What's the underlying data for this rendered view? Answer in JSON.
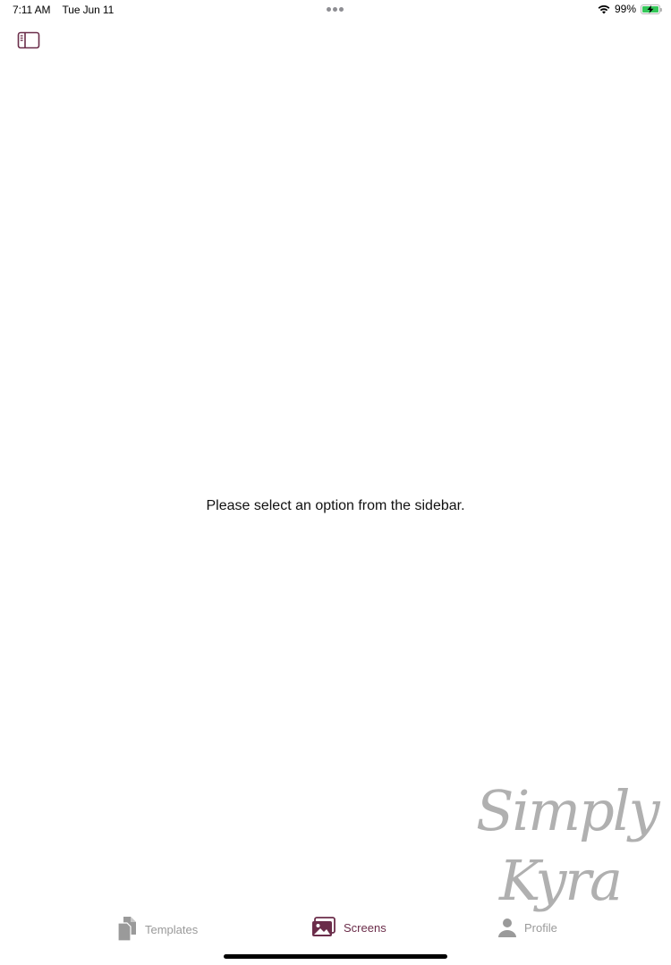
{
  "status_bar": {
    "time": "7:11 AM",
    "date": "Tue Jun 11",
    "battery": "99%",
    "battery_level": 0.99,
    "battery_color": "#34c759"
  },
  "toolbar": {
    "sidebar_toggle_icon": "sidebar-left-icon"
  },
  "main": {
    "message": "Please select an option from the sidebar."
  },
  "tab_bar": {
    "tabs": [
      {
        "label": "Templates",
        "icon": "documents-icon",
        "selected": false
      },
      {
        "label": "Screens",
        "icon": "photos-icon",
        "selected": true
      },
      {
        "label": "Profile",
        "icon": "person-icon",
        "selected": false
      }
    ]
  },
  "watermark": {
    "line1": "Simply",
    "line2": "Kyra"
  },
  "colors": {
    "accent": "#6b2d4a",
    "inactive": "#9a9a9a"
  }
}
